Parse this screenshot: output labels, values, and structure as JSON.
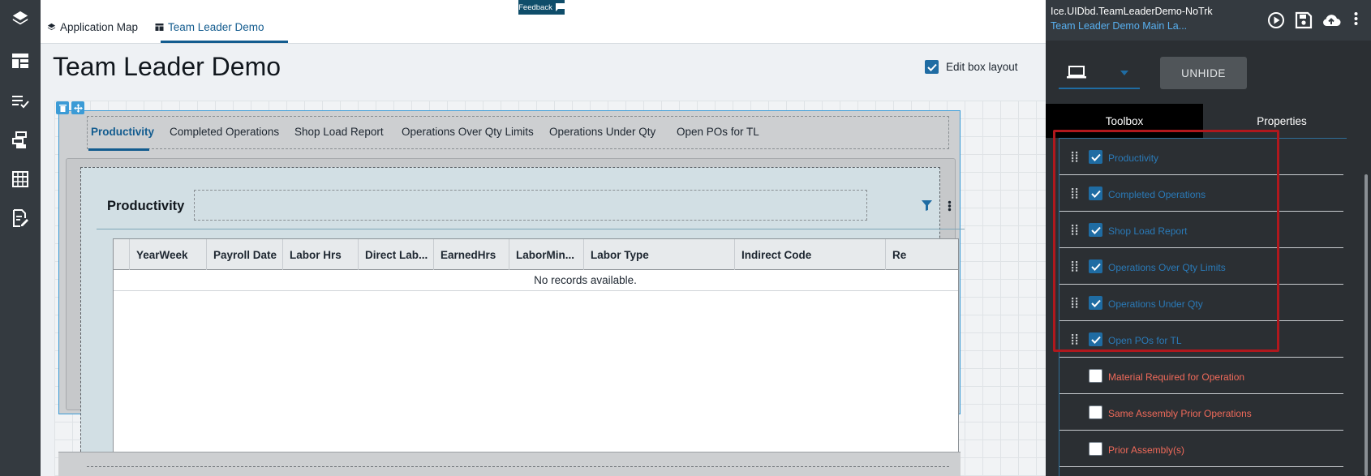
{
  "top_tabs": [
    {
      "label": "Application Map",
      "icon": "layers-icon"
    },
    {
      "label": "Team Leader Demo",
      "icon": "layout-icon"
    }
  ],
  "feedback": {
    "label": "Feedback"
  },
  "page": {
    "title": "Team Leader Demo",
    "edit_box_layout": {
      "label": "Edit box layout",
      "checked": true
    }
  },
  "inner_tabs": [
    "Productivity",
    "Completed Operations",
    "Shop Load Report",
    "Operations Over Qty Limits",
    "Operations Under Qty",
    "Open POs for TL"
  ],
  "panel": {
    "title": "Productivity",
    "columns": [
      "YearWeek",
      "Payroll Date",
      "Labor Hrs",
      "Direct Lab...",
      "EarnedHrs",
      "LaborMin...",
      "Labor Type",
      "Indirect Code",
      "Re"
    ],
    "empty_message": "No records available."
  },
  "right_panel": {
    "title": "Ice.UIDbd.TeamLeaderDemo-NoTrk",
    "subtitle": "Team Leader Demo Main La...",
    "unhide_label": "UNHIDE",
    "tabs": {
      "toolbox": "Toolbox",
      "properties": "Properties"
    },
    "items": [
      {
        "label": "Productivity",
        "checked": true
      },
      {
        "label": "Completed Operations",
        "checked": true
      },
      {
        "label": "Shop Load Report",
        "checked": true
      },
      {
        "label": "Operations Over Qty Limits",
        "checked": true
      },
      {
        "label": "Operations Under Qty",
        "checked": true
      },
      {
        "label": "Open POs for TL",
        "checked": true
      },
      {
        "label": "Material Required for Operation",
        "checked": false
      },
      {
        "label": "Same Assembly Prior Operations",
        "checked": false
      },
      {
        "label": "Prior Assembly(s)",
        "checked": false
      }
    ]
  },
  "colors": {
    "accent": "#135c8f",
    "rail_bg": "#343a40",
    "visible_item": "#2a7ab8",
    "hidden_item": "#f06a5a",
    "highlight": "#b0181d"
  }
}
